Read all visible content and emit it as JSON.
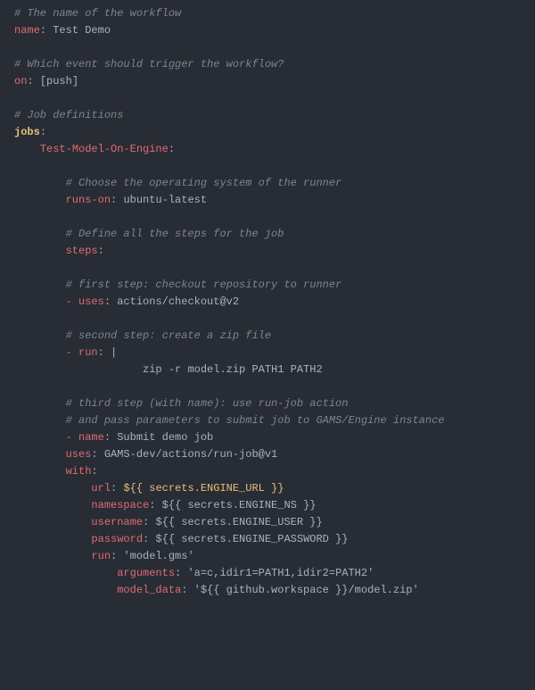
{
  "lines": {
    "c_name": "# The name of the workflow",
    "k_name": "name",
    "v_name": "Test Demo",
    "c_on": "# Which event should trigger the workflow?",
    "k_on": "on",
    "v_on": "[push]",
    "c_jobs": "# Job definitions",
    "k_jobs": "jobs",
    "k_testmodel": "Test-Model-On-Engine",
    "c_runs": "# Choose the operating system of the runner",
    "k_runs": "runs-on",
    "v_runs": "ubuntu-latest",
    "c_steps": "# Define all the steps for the job",
    "k_steps": "steps",
    "c_step1": "# first step: checkout repository to runner",
    "k_uses1": "- uses",
    "v_uses1": "actions/checkout@v2",
    "c_step2": "# second step: create a zip file",
    "k_run1": "- run",
    "v_run1": "|",
    "v_zip": "zip -r model.zip PATH1 PATH2",
    "c_step3a": "# third step (with name): use run-job action",
    "c_step3b": "# and pass parameters to submit job to GAMS/Engine instance",
    "k_name2": "- name",
    "v_name2": "Submit demo job",
    "k_uses2": "uses",
    "v_uses2": "GAMS-dev/actions/run-job@v1",
    "k_with": "with",
    "k_url": "url",
    "v_url": "${{ secrets.ENGINE_URL }}",
    "k_ns": "namespace",
    "v_ns": "${{ secrets.ENGINE_NS }}",
    "k_user": "username",
    "v_user": "${{ secrets.ENGINE_USER }}",
    "k_pw": "password",
    "v_pw": "${{ secrets.ENGINE_PASSWORD }}",
    "k_run2": "run",
    "v_run2": "'model.gms'",
    "k_args": "arguments",
    "v_args": "'a=c,idir1=PATH1,idir2=PATH2'",
    "k_md": "model_data",
    "v_md": "'${{ github.workspace }}/model.zip'",
    "colon": ":",
    "space": " "
  }
}
